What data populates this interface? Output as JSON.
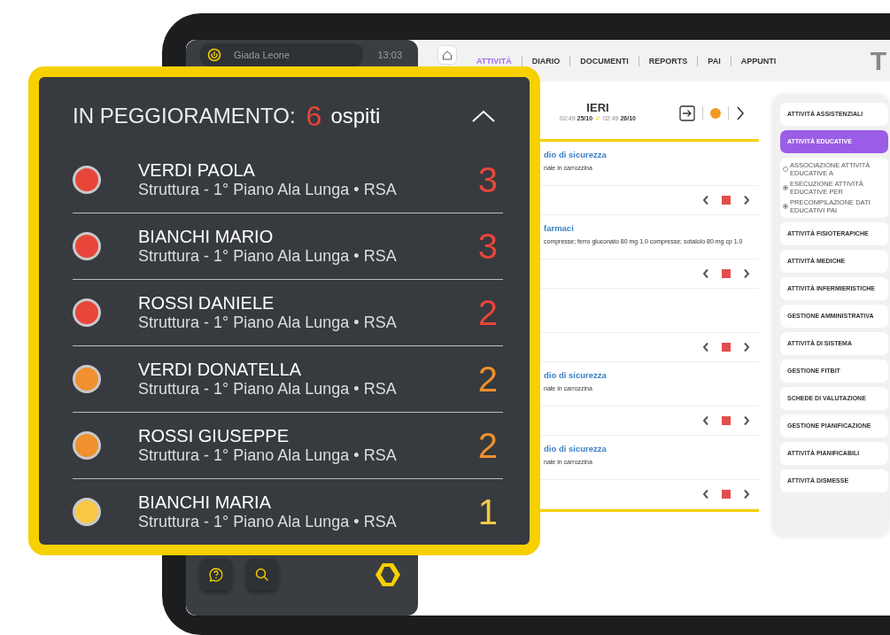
{
  "sidebar": {
    "user": "Giada Leone",
    "time": "13:03"
  },
  "nav": {
    "tabs": [
      {
        "label": "ATTIVITÀ",
        "selected": true
      },
      {
        "label": "DIARIO",
        "selected": false
      },
      {
        "label": "DOCUMENTI",
        "selected": false
      },
      {
        "label": "REPORTS",
        "selected": false
      },
      {
        "label": "PAI",
        "selected": false
      },
      {
        "label": "APPUNTI",
        "selected": false
      }
    ],
    "title_cut": "T"
  },
  "day_header": {
    "title": "IERI",
    "from": "02:49 **25/10**",
    "separator": "//",
    "to": "02:49 **26/10**"
  },
  "entries": [
    {
      "kind": "note",
      "title": "dio di sicurezza",
      "text": "nale in carrozzina"
    },
    {
      "kind": "note",
      "title": "farmaci",
      "text": "compresse; ferro gluconato 80 mg 1.0 compresse; sotalolo 80 mg cp 1.0"
    },
    {
      "kind": "empty"
    },
    {
      "kind": "note",
      "title": "dio di sicurezza",
      "text": "nale in carrozzina"
    },
    {
      "kind": "note",
      "title": "dio di sicurezza",
      "text": "nale in carrozzina"
    }
  ],
  "categories": [
    {
      "label": "ATTIVITÀ ASSISTENZIALI",
      "selected": false
    },
    {
      "label": "ATTIVITÀ EDUCATIVE",
      "selected": true,
      "options": [
        {
          "label": "ASSOCIAZIONE ATTIVITÀ EDUCATIVE A",
          "checked": false
        },
        {
          "label": "ESECUZIONE ATTIVITÀ EDUCATIVE PER",
          "checked": true
        },
        {
          "label": "PRECOMPILAZIONE DATI EDUCATIVI PAI",
          "checked": true
        }
      ]
    },
    {
      "label": "ATTIVITÀ FISIOTERAPICHE",
      "selected": false
    },
    {
      "label": "ATTIVITÀ MEDICHE",
      "selected": false
    },
    {
      "label": "ATTIVITÀ INFERMIERISTICHE",
      "selected": false
    },
    {
      "label": "GESTIONE AMMINISTRATIVA",
      "selected": false
    },
    {
      "label": "ATTIVITÀ DI SISTEMA",
      "selected": false
    },
    {
      "label": "GESTIONE FITBIT",
      "selected": false
    },
    {
      "label": "SCHEDE DI VALUTAZIONE",
      "selected": false
    },
    {
      "label": "GESTIONE PIANIFICAZIONE",
      "selected": false
    },
    {
      "label": "ATTIVITÀ PIANIFICABILI",
      "selected": false
    },
    {
      "label": "ATTIVITÀ DISMESSE",
      "selected": false
    }
  ],
  "worsening_panel": {
    "title": "IN PEGGIORAMENTO:",
    "count": "6",
    "unit": "ospiti",
    "expanded": true,
    "guests": [
      {
        "name": "VERDI PAOLA",
        "location": "Struttura - 1° Piano Ala Lunga • RSA",
        "score": "3",
        "color": "#e8463a"
      },
      {
        "name": "BIANCHI MARIO",
        "location": "Struttura - 1° Piano Ala Lunga • RSA",
        "score": "3",
        "color": "#e8463a"
      },
      {
        "name": "ROSSI DANIELE",
        "location": "Struttura - 1° Piano Ala Lunga • RSA",
        "score": "2",
        "color": "#e8463a"
      },
      {
        "name": "VERDI DONATELLA",
        "location": "Struttura - 1° Piano Ala Lunga • RSA",
        "score": "2",
        "color": "#f0902e"
      },
      {
        "name": "ROSSI GIUSEPPE",
        "location": "Struttura - 1° Piano Ala Lunga • RSA",
        "score": "2",
        "color": "#f0902e"
      },
      {
        "name": "BIANCHI MARIA",
        "location": "Struttura - 1° Piano Ala Lunga • RSA",
        "score": "1",
        "color": "#f9c846"
      }
    ]
  }
}
